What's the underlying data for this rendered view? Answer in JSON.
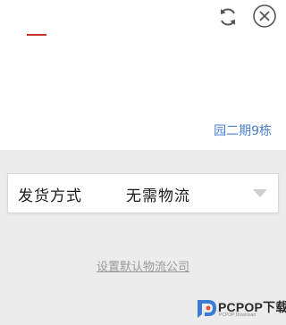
{
  "header": {
    "refresh_icon": "refresh-icon",
    "close_icon": "close-icon"
  },
  "address": {
    "text": "园二期9栋"
  },
  "shipping": {
    "label": "发货方式",
    "value": "无需物流"
  },
  "default_link": {
    "text": "设置默认物流公司"
  },
  "watermark": {
    "brand": "PCPOP下载",
    "sub": "PCPOP Download"
  },
  "colors": {
    "accent": "#c8302a",
    "link": "#4a7fd0",
    "background": "#ececec"
  }
}
